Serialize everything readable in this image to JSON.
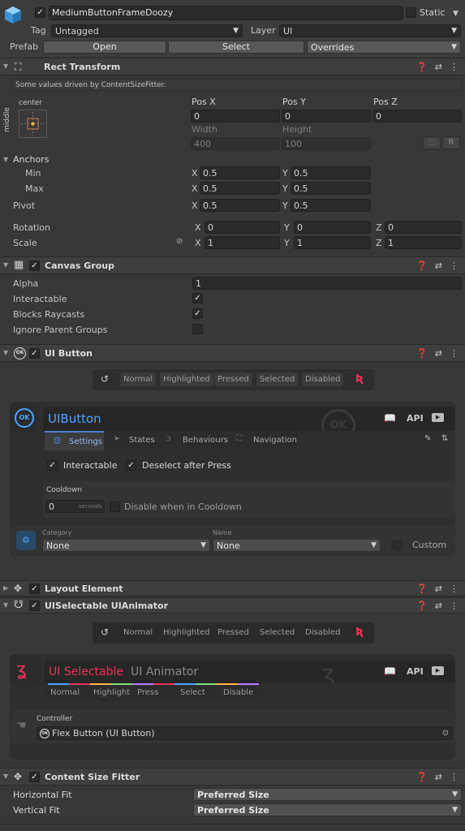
{
  "gameobject": {
    "name": "MediumButtonFrameDoozy",
    "static_label": "Static",
    "tag_label": "Tag",
    "tag_value": "Untagged",
    "layer_label": "Layer",
    "layer_value": "UI",
    "prefab_label": "Prefab",
    "open": "Open",
    "select": "Select",
    "overrides": "Overrides"
  },
  "rect_transform": {
    "title": "Rect Transform",
    "notice": "Some values driven by ContentSizeFitter.",
    "anchor_preset_h": "center",
    "anchor_preset_v": "middle",
    "pos_x_label": "Pos X",
    "pos_y_label": "Pos Y",
    "pos_z_label": "Pos Z",
    "pos_x": "0",
    "pos_y": "0",
    "pos_z": "0",
    "width_label": "Width",
    "height_label": "Height",
    "width": "400",
    "height": "100",
    "r_button": "R",
    "anchors_label": "Anchors",
    "min_label": "Min",
    "max_label": "Max",
    "pivot_label": "Pivot",
    "x": "X",
    "y": "Y",
    "z": "Z",
    "min_x": "0.5",
    "min_y": "0.5",
    "max_x": "0.5",
    "max_y": "0.5",
    "pivot_x": "0.5",
    "pivot_y": "0.5",
    "rotation_label": "Rotation",
    "rot_x": "0",
    "rot_y": "0",
    "rot_z": "0",
    "scale_label": "Scale",
    "scale_x": "1",
    "scale_y": "1",
    "scale_z": "1"
  },
  "canvas_group": {
    "title": "Canvas Group",
    "alpha_label": "Alpha",
    "alpha": "1",
    "interactable_label": "Interactable",
    "blocks_label": "Blocks Raycasts",
    "ignore_label": "Ignore Parent Groups"
  },
  "ui_button": {
    "title": "UI Button",
    "states": [
      "Normal",
      "Highlighted",
      "Pressed",
      "Selected",
      "Disabled"
    ],
    "name": "UIButton",
    "api": "API",
    "tabs": [
      "Settings",
      "States",
      "Behaviours",
      "Navigation"
    ],
    "interactable": "Interactable",
    "deselect": "Deselect after Press",
    "cooldown_label": "Cooldown",
    "cooldown_value": "0",
    "seconds": "seconds",
    "disable_cooldown": "Disable when in Cooldown",
    "category_label": "Category",
    "name_label": "Name",
    "category_value": "None",
    "name_value": "None",
    "custom": "Custom"
  },
  "layout_element": {
    "title": "Layout Element"
  },
  "ui_selectable_animator": {
    "title": "UISelectable UIAnimator",
    "states": [
      "Normal",
      "Highlighted",
      "Pressed",
      "Selected",
      "Disabled"
    ],
    "name_red": "UI Selectable",
    "name_gray": "UI Animator",
    "api": "API",
    "tabs": [
      "Normal",
      "Highlight",
      "Press",
      "Select",
      "Disable"
    ],
    "controller_label": "Controller",
    "controller_value": "Flex Button (UI Button)"
  },
  "content_size_fitter": {
    "title": "Content Size Fitter",
    "h_label": "Horizontal Fit",
    "v_label": "Vertical Fit",
    "h_value": "Preferred Size",
    "v_value": "Preferred Size"
  },
  "colors": {
    "accent_blue": "#4aa3ff",
    "doozy_red": "#e8345a",
    "tab_active": "#4a7fd0"
  }
}
